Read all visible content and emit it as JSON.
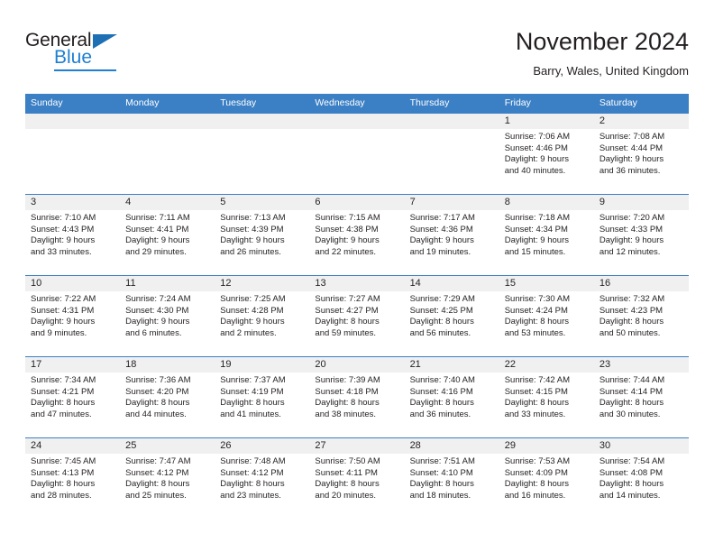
{
  "brand": {
    "name_part1": "General",
    "name_part2": "Blue",
    "triangle_color": "#1f6fb5",
    "blue_color": "#1f7fd0"
  },
  "header": {
    "title": "November 2024",
    "subtitle": "Barry, Wales, United Kingdom",
    "header_bg": "#3b7fc4",
    "daynum_bg": "#f0f0f0"
  },
  "weekday_headers": [
    "Sunday",
    "Monday",
    "Tuesday",
    "Wednesday",
    "Thursday",
    "Friday",
    "Saturday"
  ],
  "weeks": [
    [
      {
        "day": "",
        "lines": []
      },
      {
        "day": "",
        "lines": []
      },
      {
        "day": "",
        "lines": []
      },
      {
        "day": "",
        "lines": []
      },
      {
        "day": "",
        "lines": []
      },
      {
        "day": "1",
        "lines": [
          "Sunrise: 7:06 AM",
          "Sunset: 4:46 PM",
          "Daylight: 9 hours",
          "and 40 minutes."
        ]
      },
      {
        "day": "2",
        "lines": [
          "Sunrise: 7:08 AM",
          "Sunset: 4:44 PM",
          "Daylight: 9 hours",
          "and 36 minutes."
        ]
      }
    ],
    [
      {
        "day": "3",
        "lines": [
          "Sunrise: 7:10 AM",
          "Sunset: 4:43 PM",
          "Daylight: 9 hours",
          "and 33 minutes."
        ]
      },
      {
        "day": "4",
        "lines": [
          "Sunrise: 7:11 AM",
          "Sunset: 4:41 PM",
          "Daylight: 9 hours",
          "and 29 minutes."
        ]
      },
      {
        "day": "5",
        "lines": [
          "Sunrise: 7:13 AM",
          "Sunset: 4:39 PM",
          "Daylight: 9 hours",
          "and 26 minutes."
        ]
      },
      {
        "day": "6",
        "lines": [
          "Sunrise: 7:15 AM",
          "Sunset: 4:38 PM",
          "Daylight: 9 hours",
          "and 22 minutes."
        ]
      },
      {
        "day": "7",
        "lines": [
          "Sunrise: 7:17 AM",
          "Sunset: 4:36 PM",
          "Daylight: 9 hours",
          "and 19 minutes."
        ]
      },
      {
        "day": "8",
        "lines": [
          "Sunrise: 7:18 AM",
          "Sunset: 4:34 PM",
          "Daylight: 9 hours",
          "and 15 minutes."
        ]
      },
      {
        "day": "9",
        "lines": [
          "Sunrise: 7:20 AM",
          "Sunset: 4:33 PM",
          "Daylight: 9 hours",
          "and 12 minutes."
        ]
      }
    ],
    [
      {
        "day": "10",
        "lines": [
          "Sunrise: 7:22 AM",
          "Sunset: 4:31 PM",
          "Daylight: 9 hours",
          "and 9 minutes."
        ]
      },
      {
        "day": "11",
        "lines": [
          "Sunrise: 7:24 AM",
          "Sunset: 4:30 PM",
          "Daylight: 9 hours",
          "and 6 minutes."
        ]
      },
      {
        "day": "12",
        "lines": [
          "Sunrise: 7:25 AM",
          "Sunset: 4:28 PM",
          "Daylight: 9 hours",
          "and 2 minutes."
        ]
      },
      {
        "day": "13",
        "lines": [
          "Sunrise: 7:27 AM",
          "Sunset: 4:27 PM",
          "Daylight: 8 hours",
          "and 59 minutes."
        ]
      },
      {
        "day": "14",
        "lines": [
          "Sunrise: 7:29 AM",
          "Sunset: 4:25 PM",
          "Daylight: 8 hours",
          "and 56 minutes."
        ]
      },
      {
        "day": "15",
        "lines": [
          "Sunrise: 7:30 AM",
          "Sunset: 4:24 PM",
          "Daylight: 8 hours",
          "and 53 minutes."
        ]
      },
      {
        "day": "16",
        "lines": [
          "Sunrise: 7:32 AM",
          "Sunset: 4:23 PM",
          "Daylight: 8 hours",
          "and 50 minutes."
        ]
      }
    ],
    [
      {
        "day": "17",
        "lines": [
          "Sunrise: 7:34 AM",
          "Sunset: 4:21 PM",
          "Daylight: 8 hours",
          "and 47 minutes."
        ]
      },
      {
        "day": "18",
        "lines": [
          "Sunrise: 7:36 AM",
          "Sunset: 4:20 PM",
          "Daylight: 8 hours",
          "and 44 minutes."
        ]
      },
      {
        "day": "19",
        "lines": [
          "Sunrise: 7:37 AM",
          "Sunset: 4:19 PM",
          "Daylight: 8 hours",
          "and 41 minutes."
        ]
      },
      {
        "day": "20",
        "lines": [
          "Sunrise: 7:39 AM",
          "Sunset: 4:18 PM",
          "Daylight: 8 hours",
          "and 38 minutes."
        ]
      },
      {
        "day": "21",
        "lines": [
          "Sunrise: 7:40 AM",
          "Sunset: 4:16 PM",
          "Daylight: 8 hours",
          "and 36 minutes."
        ]
      },
      {
        "day": "22",
        "lines": [
          "Sunrise: 7:42 AM",
          "Sunset: 4:15 PM",
          "Daylight: 8 hours",
          "and 33 minutes."
        ]
      },
      {
        "day": "23",
        "lines": [
          "Sunrise: 7:44 AM",
          "Sunset: 4:14 PM",
          "Daylight: 8 hours",
          "and 30 minutes."
        ]
      }
    ],
    [
      {
        "day": "24",
        "lines": [
          "Sunrise: 7:45 AM",
          "Sunset: 4:13 PM",
          "Daylight: 8 hours",
          "and 28 minutes."
        ]
      },
      {
        "day": "25",
        "lines": [
          "Sunrise: 7:47 AM",
          "Sunset: 4:12 PM",
          "Daylight: 8 hours",
          "and 25 minutes."
        ]
      },
      {
        "day": "26",
        "lines": [
          "Sunrise: 7:48 AM",
          "Sunset: 4:12 PM",
          "Daylight: 8 hours",
          "and 23 minutes."
        ]
      },
      {
        "day": "27",
        "lines": [
          "Sunrise: 7:50 AM",
          "Sunset: 4:11 PM",
          "Daylight: 8 hours",
          "and 20 minutes."
        ]
      },
      {
        "day": "28",
        "lines": [
          "Sunrise: 7:51 AM",
          "Sunset: 4:10 PM",
          "Daylight: 8 hours",
          "and 18 minutes."
        ]
      },
      {
        "day": "29",
        "lines": [
          "Sunrise: 7:53 AM",
          "Sunset: 4:09 PM",
          "Daylight: 8 hours",
          "and 16 minutes."
        ]
      },
      {
        "day": "30",
        "lines": [
          "Sunrise: 7:54 AM",
          "Sunset: 4:08 PM",
          "Daylight: 8 hours",
          "and 14 minutes."
        ]
      }
    ]
  ]
}
